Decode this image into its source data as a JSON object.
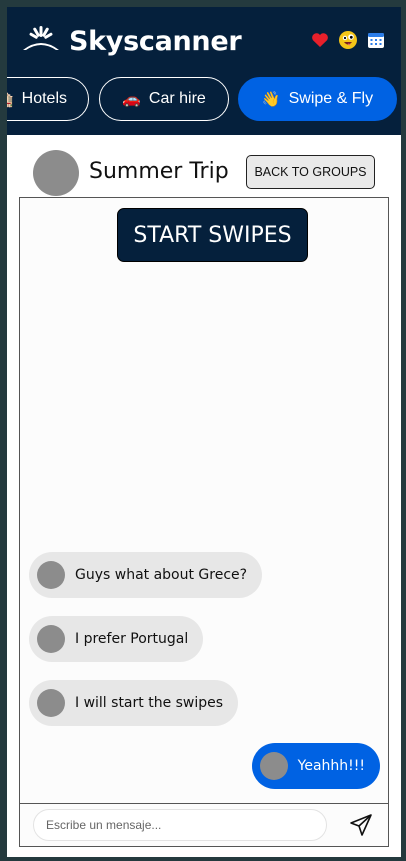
{
  "header": {
    "brand": "Skyscanner",
    "icons": [
      "heart-icon",
      "emoji-face-icon",
      "calendar-icon"
    ],
    "accent": "#0062e3",
    "background": "#05203c"
  },
  "tabs": [
    {
      "emoji": "🏨",
      "label": "Hotels",
      "active": false
    },
    {
      "emoji": "🚗",
      "label": "Car hire",
      "active": false
    },
    {
      "emoji": "👋",
      "label": "Swipe & Fly",
      "active": true
    }
  ],
  "group": {
    "title": "Summer Trip",
    "back_label": "BACK TO GROUPS"
  },
  "chat": {
    "start_label": "START SWIPES",
    "messages": [
      {
        "text": "Guys what about Grece?",
        "direction": "in"
      },
      {
        "text": "I prefer Portugal",
        "direction": "in"
      },
      {
        "text": "I will start the swipes",
        "direction": "in"
      },
      {
        "text": "Yeahhh!!!",
        "direction": "out"
      }
    ],
    "composer": {
      "value": "",
      "placeholder": "Escribe un mensaje..."
    }
  }
}
